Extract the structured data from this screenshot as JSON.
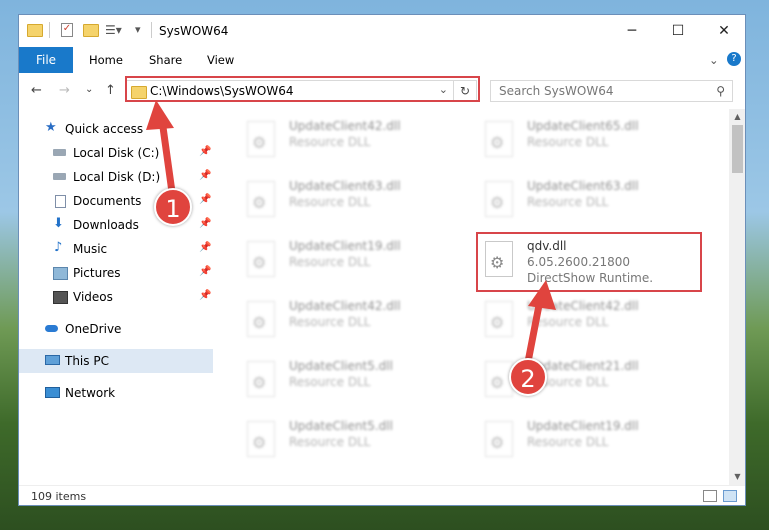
{
  "window": {
    "title": "SysWOW64"
  },
  "controls": {
    "minimize": "─",
    "maximize": "☐",
    "close": "✕"
  },
  "ribbon": {
    "file": "File",
    "home": "Home",
    "share": "Share",
    "view": "View",
    "expand": "⌄",
    "help": "?"
  },
  "nav": {
    "back": "←",
    "forward": "→",
    "recent": "⌄",
    "up": "↑"
  },
  "address": {
    "path": "C:\\Windows\\SysWOW64",
    "dropdown": "⌄",
    "refresh": "↻"
  },
  "search": {
    "placeholder": "Search SysWOW64"
  },
  "sidebar": {
    "items": [
      {
        "label": "Quick access",
        "icon": "star-icon",
        "pinned": false
      },
      {
        "label": "Local Disk (C:)",
        "icon": "disk-icon",
        "pinned": true
      },
      {
        "label": "Local Disk (D:)",
        "icon": "disk-icon",
        "pinned": true
      },
      {
        "label": "Documents",
        "icon": "document-icon",
        "pinned": true
      },
      {
        "label": "Downloads",
        "icon": "download-icon",
        "pinned": true
      },
      {
        "label": "Music",
        "icon": "music-icon",
        "pinned": true
      },
      {
        "label": "Pictures",
        "icon": "pictures-icon",
        "pinned": true
      },
      {
        "label": "Videos",
        "icon": "videos-icon",
        "pinned": true
      },
      {
        "label": "OneDrive",
        "icon": "cloud-icon",
        "pinned": false
      },
      {
        "label": "This PC",
        "icon": "computer-icon",
        "pinned": false
      },
      {
        "label": "Network",
        "icon": "network-icon",
        "pinned": false
      }
    ],
    "pin_glyph": "📌"
  },
  "files": [
    {
      "name": "UpdateClient42.dll",
      "type": "Resource DLL"
    },
    {
      "name": "UpdateClient65.dll",
      "type": "Resource DLL"
    },
    {
      "name": "UpdateClient63.dll",
      "type": "Resource DLL"
    },
    {
      "name": "UpdateClient63.dll",
      "type": "Resource DLL"
    },
    {
      "name": "UpdateClient19.dll",
      "type": "Resource DLL"
    },
    {
      "name": "qdv.dll",
      "version": "6.05.2600.21800",
      "type": "DirectShow Runtime."
    },
    {
      "name": "UpdateClient42.dll",
      "type": "Resource DLL"
    },
    {
      "name": "UpdateClient42.dll",
      "type": "Resource DLL"
    },
    {
      "name": "UpdateClient5.dll",
      "type": "Resource DLL"
    },
    {
      "name": "UpdateClient21.dll",
      "type": "Resource DLL"
    },
    {
      "name": "UpdateClient5.dll",
      "type": "Resource DLL"
    },
    {
      "name": "UpdateClient19.dll",
      "type": "Resource DLL"
    }
  ],
  "status": {
    "count": "109 items"
  },
  "annotations": {
    "step1": "1",
    "step2": "2",
    "color": "#d8454a"
  },
  "colors": {
    "file_tab": "#1979ca",
    "selected_nav": "#dde8f4",
    "highlight": "#d8454a"
  }
}
